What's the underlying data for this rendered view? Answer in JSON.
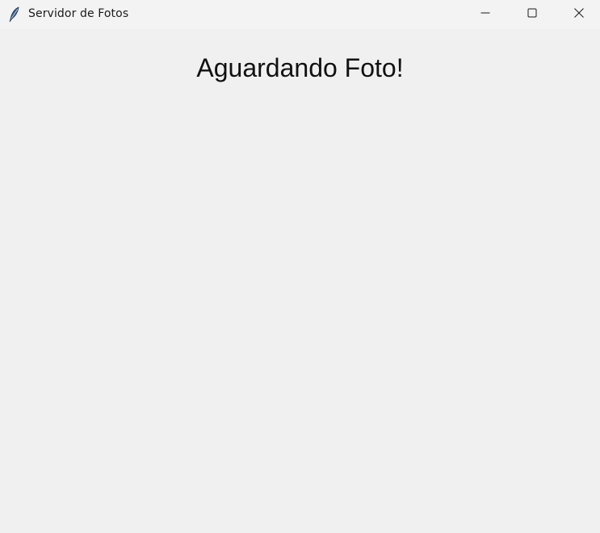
{
  "window": {
    "title": "Servidor de Fotos",
    "icon": "feather-icon",
    "controls": {
      "minimize": "minimize-icon",
      "maximize": "maximize-icon",
      "close": "close-icon"
    }
  },
  "main": {
    "status_text": "Aguardando Foto!"
  },
  "colors": {
    "background": "#f0f0f0",
    "titlebar": "#f3f3f3",
    "text": "#111111"
  }
}
